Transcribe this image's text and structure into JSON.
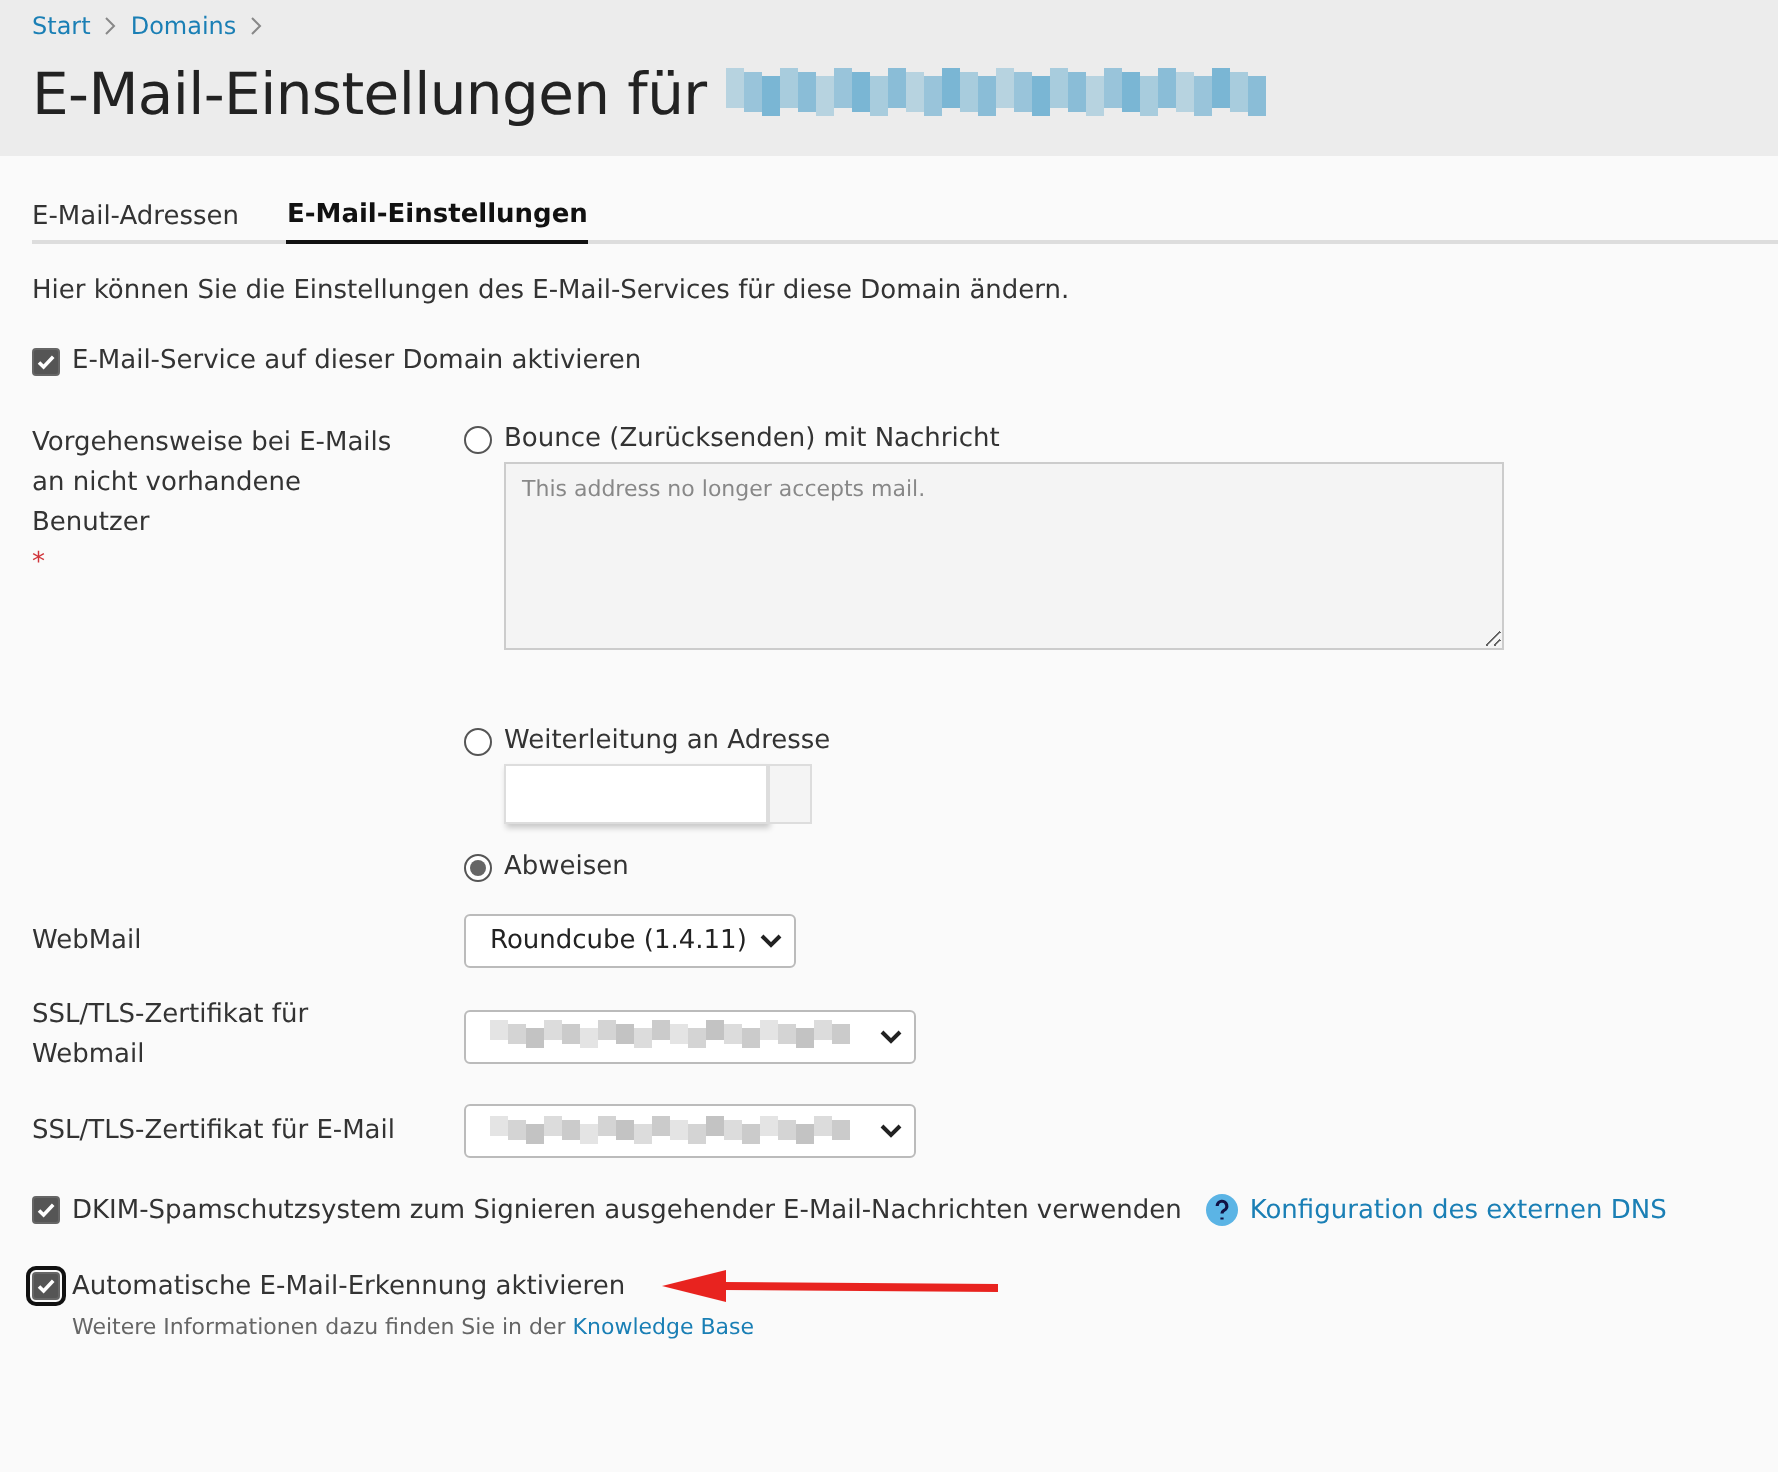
{
  "breadcrumbs": [
    {
      "label": "Start"
    },
    {
      "label": "Domains"
    }
  ],
  "title": "E-Mail-Einstellungen für",
  "tabs": [
    {
      "label": "E-Mail-Adressen",
      "selected": false
    },
    {
      "label": "E-Mail-Einstellungen",
      "selected": true
    }
  ],
  "intro": "Hier können Sie die Einstellungen des E-Mail-Services für diese Domain ändern.",
  "service_checkbox": {
    "label": "E-Mail-Service auf dieser Domain aktivieren",
    "checked": true
  },
  "nonexistent_users": {
    "label": "Vorgehensweise bei E-Mails an nicht vorhandene Benutzer",
    "required_mark": "*",
    "options": [
      {
        "label": "Bounce (Zurücksenden) mit Nachricht",
        "selected": false,
        "kind": "textarea",
        "value": "This address no longer accepts mail."
      },
      {
        "label": "Weiterleitung an Adresse",
        "selected": false,
        "kind": "input"
      },
      {
        "label": "Abweisen",
        "selected": true,
        "kind": "plain"
      }
    ]
  },
  "webmail": {
    "label": "WebMail",
    "value": "Roundcube (1.4.11)"
  },
  "certificates": [
    {
      "label": "SSL/TLS-Zertifikat für Webmail"
    },
    {
      "label": "SSL/TLS-Zertifikat für E-Mail"
    }
  ],
  "dkim": {
    "label": "DKIM-Spamschutzsystem zum Signieren ausgehender E-Mail-Nachrichten verwenden",
    "checked": true,
    "link": "Konfiguration des externen DNS"
  },
  "autodiscover": {
    "label": "Automatische E-Mail-Erkennung aktivieren",
    "checked": true,
    "focused": true,
    "hint": "Weitere Informationen dazu finden Sie in der",
    "link": "Knowledge Base"
  }
}
